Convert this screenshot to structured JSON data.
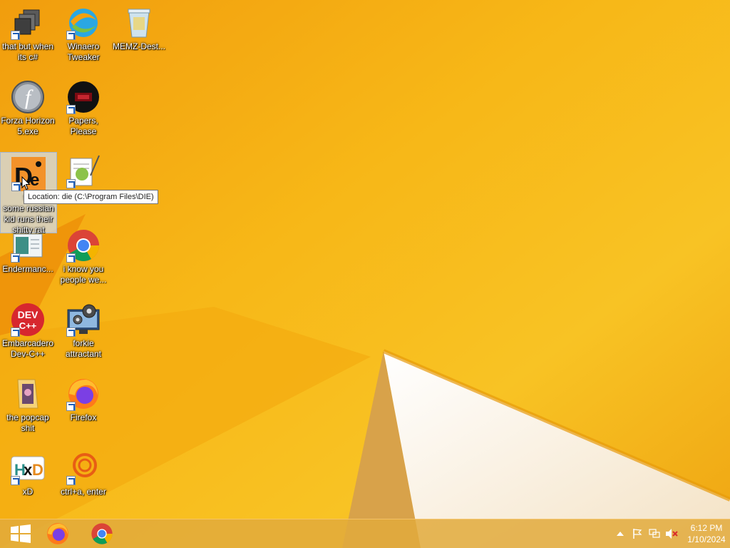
{
  "desktop": {
    "icons": [
      {
        "label": "that but when its c#"
      },
      {
        "label": "Winaero Tweaker"
      },
      {
        "label": "MEMZ-Dest..."
      },
      {
        "label": "Forza Horizon 5.exe"
      },
      {
        "label": "Papers, Please"
      },
      {
        "label": "for some russian kid runs their shitty rat",
        "visible_fragment": "for",
        "visible_rest": "some russian kid runs their shitty rat"
      },
      {
        "label": ""
      },
      {
        "label": "Endermanc..."
      },
      {
        "label": "i know you people we..."
      },
      {
        "label": "Embarcadero Dev-C++"
      },
      {
        "label": "forkie attractant"
      },
      {
        "label": "the popcap shit"
      },
      {
        "label": "Firefox"
      },
      {
        "label": "xD"
      },
      {
        "label": "ctrl+a, enter"
      }
    ],
    "dev_badge": {
      "line1": "DEV",
      "line2": "C++"
    },
    "tooltip": "Location: die (C:\\Program Files\\DIE)"
  },
  "taskbar": {
    "start_icon": "windows-logo-icon",
    "pinned": [
      {
        "name": "firefox-icon"
      },
      {
        "name": "chrome-icon"
      }
    ],
    "tray": {
      "clock_time": "6:12 PM",
      "clock_date": "1/10/2024"
    }
  },
  "colors": {
    "wallpaper": "#f6b414",
    "taskbar": "#e2aa3c",
    "selection": "#d2dceb"
  }
}
